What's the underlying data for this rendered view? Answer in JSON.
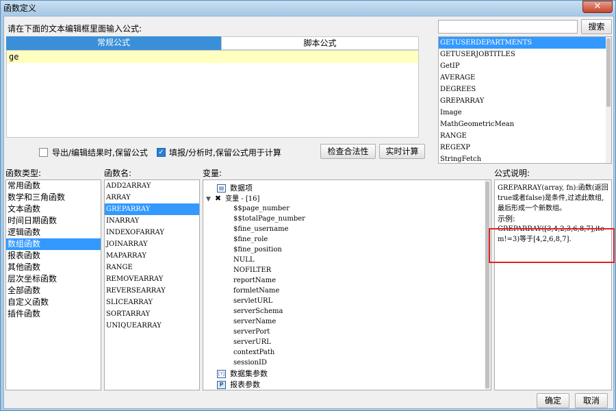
{
  "window": {
    "title": "函数定义",
    "close_label": "✕"
  },
  "editor": {
    "prompt": "请在下面的文本编辑框里面输入公式:",
    "tabs": [
      {
        "label": "常规公式",
        "active": true
      },
      {
        "label": "脚本公式",
        "active": false
      }
    ],
    "content": "ge"
  },
  "search": {
    "value": "",
    "button_label": "搜索"
  },
  "fn_suggestions": [
    "GETUSERDEPARTMENTS",
    "GETUSERJOBTITLES",
    "GetIP",
    "AVERAGE",
    "DEGREES",
    "GREPARRAY",
    "Image",
    "MathGeometricMean",
    "RANGE",
    "REGEXP",
    "StringFetch"
  ],
  "fn_suggestions_selected": 0,
  "options": {
    "export_label": "导出/编辑结果时,保留公式",
    "export_checked": false,
    "fill_label": "填报/分析时,保留公式用于计算",
    "fill_checked": true,
    "check_button": "检查合法性",
    "realtime_button": "实时计算"
  },
  "category": {
    "header": "函数类型:",
    "items": [
      "常用函数",
      "数学和三角函数",
      "文本函数",
      "时间日期函数",
      "逻辑函数",
      "数组函数",
      "报表函数",
      "其他函数",
      "层次坐标函数",
      "全部函数",
      "自定义函数",
      "插件函数"
    ],
    "selected": 5
  },
  "fname": {
    "header": "函数名:",
    "items": [
      "ADD2ARRAY",
      "ARRAY",
      "GREPARRAY",
      "INARRAY",
      "INDEXOFARRAY",
      "JOINARRAY",
      "MAPARRAY",
      "RANGE",
      "REMOVEARRAY",
      "REVERSEARRAY",
      "SLICEARRAY",
      "SORTARRAY",
      "UNIQUEARRAY"
    ],
    "selected": 2
  },
  "variables": {
    "header": "变量:",
    "data_item": "数据项",
    "var_group": "变量 - [16]",
    "vars": [
      "$$page_number",
      "$$totalPage_number",
      "$fine_username",
      "$fine_role",
      "$fine_position",
      "NULL",
      "NOFILTER",
      "reportName",
      "formletName",
      "servletURL",
      "serverSchema",
      "serverName",
      "serverPort",
      "serverURL",
      "contextPath",
      "sessionID"
    ],
    "dataset_params": "数据集参数",
    "report_params": "报表参数"
  },
  "description": {
    "header": "公式说明:",
    "text1": "GREPARRAY(array, fn):函数(返回true或者false)是条件,过滤此数组,最后形成一个新数组。",
    "text2": "示例:",
    "text3": "GREPARRAY([3,4,2,3,6,8,7],item!=3)等于[4,2,6,8,7]."
  },
  "footer": {
    "ok_label": "确定",
    "cancel_label": "取消"
  }
}
